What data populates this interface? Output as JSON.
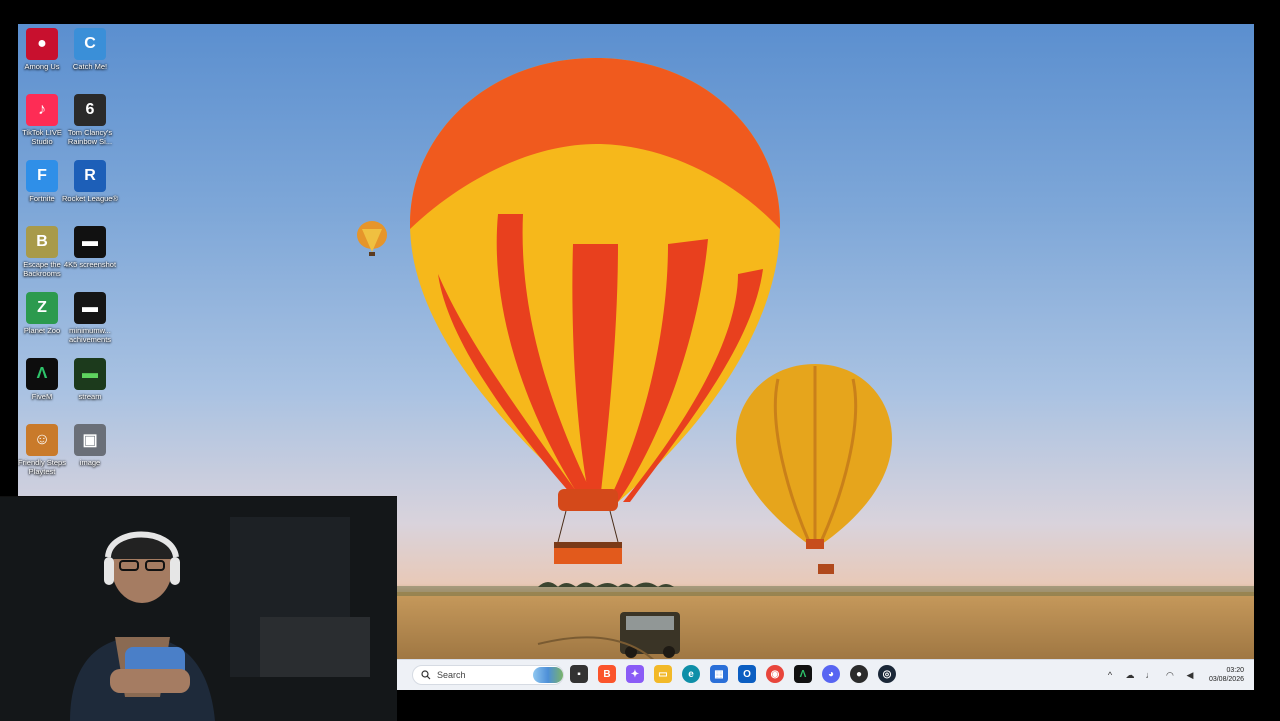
{
  "desktop": {
    "icons": [
      {
        "label": "Among Us",
        "color": "#c8102e",
        "glyph": "●"
      },
      {
        "label": "Catch Me!",
        "color": "#3a8fd8",
        "glyph": "C"
      },
      {
        "label": "TikTok LIVE Studio",
        "color": "#fe2c55",
        "glyph": "♪"
      },
      {
        "label": "Tom Clancy's Rainbow Si...",
        "color": "#2a2a2a",
        "glyph": "6"
      },
      {
        "label": "Fortnite",
        "color": "#2f8fe8",
        "glyph": "F"
      },
      {
        "label": "Rocket League®",
        "color": "#1d5fb8",
        "glyph": "R"
      },
      {
        "label": "Escape the Backrooms",
        "color": "#a89a4a",
        "glyph": "B"
      },
      {
        "label": "4K5 screenshot",
        "color": "#111111",
        "glyph": "▬"
      },
      {
        "label": "Planet Zoo",
        "color": "#2c9a4e",
        "glyph": "Z"
      },
      {
        "label": "minimumw... achivements",
        "color": "#151515",
        "glyph": "▬"
      },
      {
        "label": "FiveM",
        "color": "#0d0d0d",
        "glyph": "Λ"
      },
      {
        "label": "stream",
        "color": "#1c3a1c",
        "glyph": "▬"
      },
      {
        "label": "Friendly Steps Playtest",
        "color": "#c97a2a",
        "glyph": "☺"
      },
      {
        "label": "image",
        "color": "#6a6f78",
        "glyph": "▣"
      }
    ]
  },
  "taskbar": {
    "search_label": "Search",
    "apps": [
      {
        "name": "task-view",
        "color": "#333333",
        "glyph": "▪"
      },
      {
        "name": "brave",
        "color": "#fb542b",
        "glyph": "B"
      },
      {
        "name": "copilot",
        "color": "#8a5cf6",
        "glyph": "✦"
      },
      {
        "name": "file-explorer",
        "color": "#f2b928",
        "glyph": "▭"
      },
      {
        "name": "edge",
        "color": "#0f8fa8",
        "glyph": "e"
      },
      {
        "name": "store",
        "color": "#2a6fd8",
        "glyph": "▦"
      },
      {
        "name": "outlook",
        "color": "#0b5ec2",
        "glyph": "O"
      },
      {
        "name": "chrome",
        "color": "#e8453c",
        "glyph": "◉"
      },
      {
        "name": "fivem",
        "color": "#111111",
        "glyph": "Λ"
      },
      {
        "name": "discord",
        "color": "#5865f2",
        "glyph": "◕"
      },
      {
        "name": "obs",
        "color": "#2b2b2b",
        "glyph": "●"
      },
      {
        "name": "steam",
        "color": "#1b2838",
        "glyph": "◎"
      }
    ],
    "tray": {
      "time": "03:20",
      "date": "03/08/2026"
    }
  }
}
